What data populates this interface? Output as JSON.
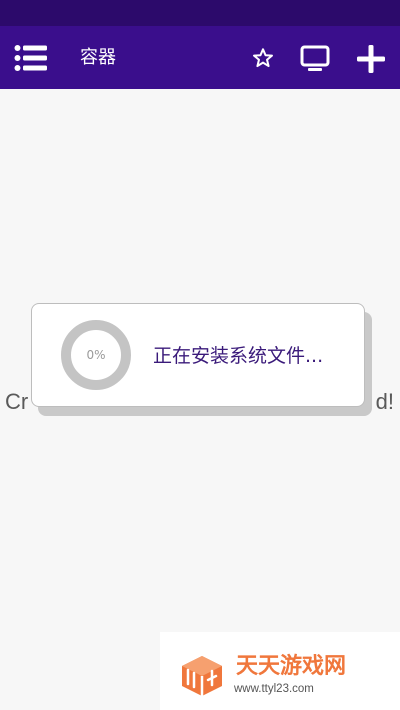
{
  "app_bar": {
    "title": "容器",
    "menu_icon": "list-menu-icon",
    "favorite_icon": "star-outline-icon",
    "display_icon": "monitor-icon",
    "add_icon": "plus-icon"
  },
  "background": {
    "text_left": "Cr",
    "text_right": "d!"
  },
  "dialog": {
    "progress_text": "0%",
    "progress_value": 0,
    "message": "正在安装系统文件..."
  },
  "watermark": {
    "title": "天天游戏网",
    "url": "www.ttyl23.com",
    "logo_icon": "cube-logo-icon"
  },
  "colors": {
    "status_bar": "#2c0a6b",
    "app_bar": "#3a0e8c",
    "message_text": "#3a1a7a",
    "watermark_orange": "#f0773c"
  }
}
